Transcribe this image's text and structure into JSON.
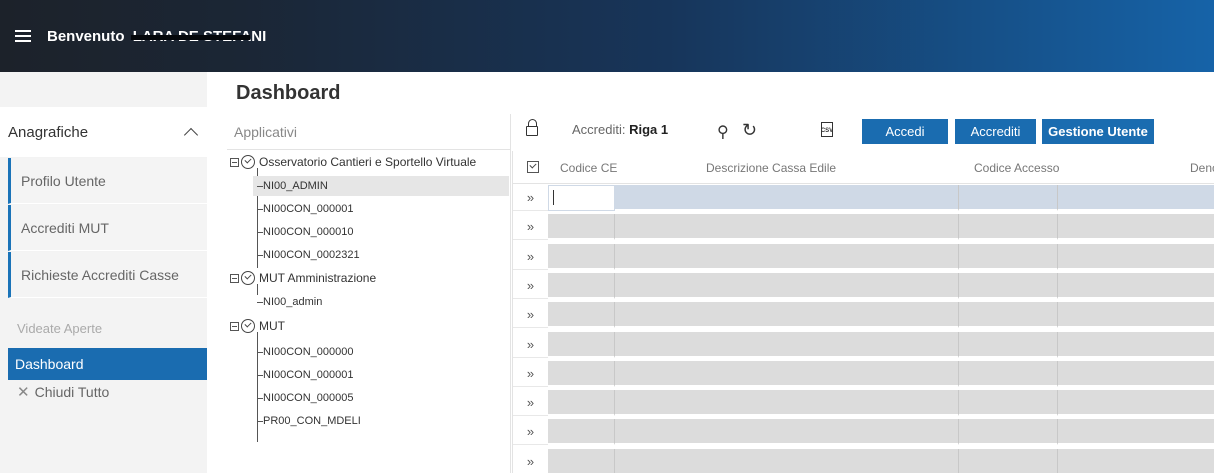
{
  "header": {
    "welcome": "Benvenuto",
    "user_name": "LARA DE STEFANI"
  },
  "sidebar": {
    "section_title": "Anagrafiche",
    "items": [
      {
        "label": "Profilo Utente"
      },
      {
        "label": "Accrediti MUT"
      },
      {
        "label": "Richieste Accrediti Casse"
      }
    ],
    "open_title": "Videate Aperte",
    "active_page": "Dashboard",
    "close_all": "Chiudi Tutto"
  },
  "main": {
    "title": "Dashboard",
    "tree": {
      "header": "Applicativi",
      "groups": [
        {
          "label": "Osservatorio Cantieri e Sportello Virtuale",
          "children": [
            "NI00_ADMIN",
            "NI00CON_000001",
            "NI00CON_000010",
            "NI00CON_0002321"
          ]
        },
        {
          "label": "MUT Amministrazione",
          "children": [
            "NI00_admin"
          ]
        },
        {
          "label": "MUT",
          "children": [
            "NI00CON_000000",
            "NI00CON_000001",
            "NI00CON_000005",
            "PR00_CON_MDELI"
          ]
        }
      ]
    },
    "toolbar": {
      "accrediti_label": "Accrediti:",
      "accrediti_value": "Riga 1",
      "csv": "CSV",
      "btn_accedi": "Accedi",
      "btn_accrediti": "Accrediti",
      "btn_gestione": "Gestione Utente"
    },
    "grid": {
      "columns": [
        "Codice CE",
        "Descrizione Cassa Edile",
        "Codice Accesso",
        "Denc"
      ],
      "row_marker": "»"
    }
  },
  "icons": {
    "menu": "hamburger-icon",
    "collapse": "chevron-up-icon",
    "close": "close-icon",
    "lock": "lock-icon",
    "search": "search-icon",
    "refresh": "refresh-icon",
    "csv": "csv-icon"
  },
  "colors": {
    "accent": "#1a6cb0",
    "header_dark": "#1c222a",
    "header_light": "#1663a8"
  }
}
